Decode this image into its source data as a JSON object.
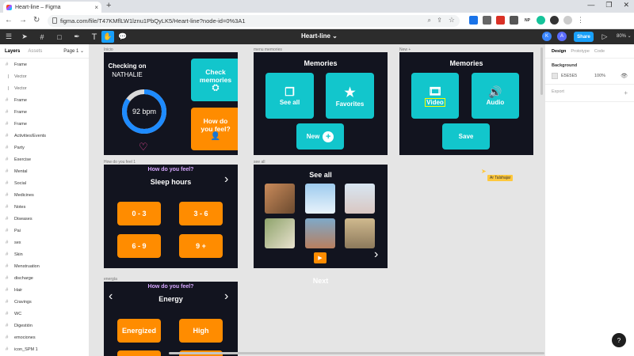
{
  "browser": {
    "tab_title": "Heart-line – Figma",
    "tab_close": "×",
    "new_tab": "+",
    "url": "figma.com/file/T47KMflLW1lznu1PbQyLK5/Heart-line?node-id=0%3A1",
    "ext_labels": [
      "",
      "",
      "",
      "",
      "NP",
      "",
      "",
      ""
    ]
  },
  "figma": {
    "file_title": "Heart-line ⌄",
    "avatar1": "K",
    "avatar2": "A",
    "share": "Share",
    "zoom": "80% ⌄"
  },
  "layers_panel": {
    "tab_layers": "Layers",
    "tab_assets": "Assets",
    "page": "Page 1 ⌄",
    "items": [
      {
        "label": "Frame",
        "sub": false
      },
      {
        "label": "Vector",
        "sub": true
      },
      {
        "label": "Vector",
        "sub": true
      },
      {
        "label": "Frame",
        "sub": false
      },
      {
        "label": "Frame",
        "sub": false
      },
      {
        "label": "Frame",
        "sub": false
      },
      {
        "label": "Activities/Events",
        "sub": false
      },
      {
        "label": "Party",
        "sub": false
      },
      {
        "label": "Exercise",
        "sub": false
      },
      {
        "label": "Mental",
        "sub": false
      },
      {
        "label": "Social",
        "sub": false
      },
      {
        "label": "Medicines",
        "sub": false
      },
      {
        "label": "Notes",
        "sub": false
      },
      {
        "label": "Diseases",
        "sub": false
      },
      {
        "label": "Pai",
        "sub": false
      },
      {
        "label": "sex",
        "sub": false
      },
      {
        "label": "Skin",
        "sub": false
      },
      {
        "label": "Menstruation",
        "sub": false
      },
      {
        "label": "discharge",
        "sub": false
      },
      {
        "label": "Hair",
        "sub": false
      },
      {
        "label": "Cravings",
        "sub": false
      },
      {
        "label": "WC",
        "sub": false
      },
      {
        "label": "Digestión",
        "sub": false
      },
      {
        "label": "emociones",
        "sub": false
      },
      {
        "label": "icon_SPM 1",
        "sub": false
      }
    ]
  },
  "canvas": {
    "frame_labels": {
      "inicio": "Inicio",
      "menu_memories": "menu memories",
      "new": "New +",
      "how_feel": "How do you feel 1",
      "see_all": "see all",
      "energia": "energía"
    },
    "inicio": {
      "checking": "Checking on",
      "name": "NATHALIE",
      "bpm": "92 bpm",
      "check_memories": "Check memories",
      "how_feel": "How do you feel?",
      "progress": 0.85
    },
    "memories": {
      "title": "Memories",
      "see_all": "See all",
      "favorites": "Favorites",
      "new": "New"
    },
    "new_frame": {
      "title": "Memories",
      "video": "Video",
      "audio": "Audio",
      "save": "Save"
    },
    "sleep": {
      "question": "How do you feel?",
      "title": "Sleep hours",
      "options": [
        "0 - 3",
        "3 - 6",
        "6 - 9",
        "9 +"
      ]
    },
    "seeall": {
      "title": "See all",
      "next": "Next"
    },
    "energy": {
      "question": "How do you feel?",
      "title": "Energy",
      "options": [
        "Energized",
        "High"
      ]
    },
    "cursor_label": "Ar Talshajar"
  },
  "design_panel": {
    "tab_design": "Design",
    "tab_prototype": "Prototype",
    "tab_code": "Code",
    "background": "Background",
    "hex": "E5E5E5",
    "opacity": "100%",
    "export": "Export",
    "export_add": "+"
  },
  "help": "?",
  "colors": {
    "teal": "#12c6cc",
    "orange": "#ff8c00",
    "frame": "#12141f",
    "figma_blue": "#18a0fb"
  }
}
